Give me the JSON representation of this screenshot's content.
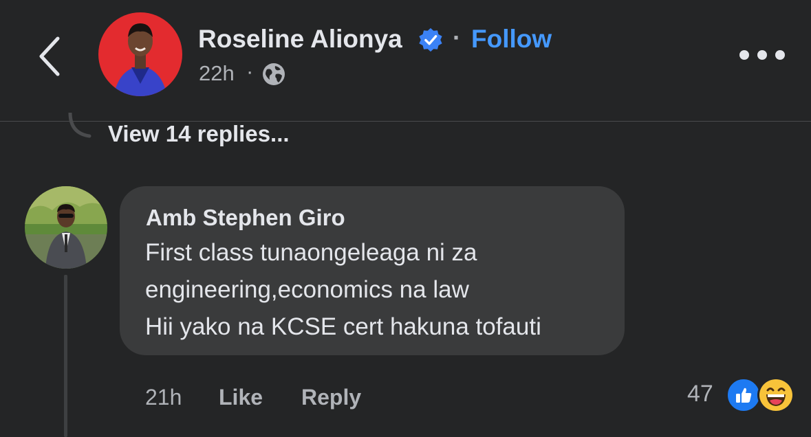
{
  "header": {
    "back_icon": "chevron-left-icon",
    "author_name": "Roseline Alionya",
    "verified_icon": "verified-badge-icon",
    "follow_separator": "·",
    "follow_label": "Follow",
    "post_time": "22h",
    "meta_separator": "·",
    "audience_icon": "globe-icon",
    "more_icon": "more-horizontal-icon"
  },
  "replies": {
    "view_replies_label": "View 14 replies..."
  },
  "comment": {
    "author": "Amb Stephen Giro",
    "text_lines": [
      "First class tunaongeleaga ni za",
      "engineering,economics na law",
      "Hii yako na KCSE cert hakuna tofauti"
    ],
    "time": "21h",
    "like_label": "Like",
    "reply_label": "Reply",
    "reaction_count": "47",
    "reactions": [
      "like-reaction-icon",
      "haha-reaction-icon"
    ]
  },
  "colors": {
    "background": "#242526",
    "bubble": "#3a3b3c",
    "link": "#4599ff",
    "verified": "#3b82f6",
    "like_reaction": "#1d7af2",
    "haha_reaction": "#f8c33a"
  }
}
